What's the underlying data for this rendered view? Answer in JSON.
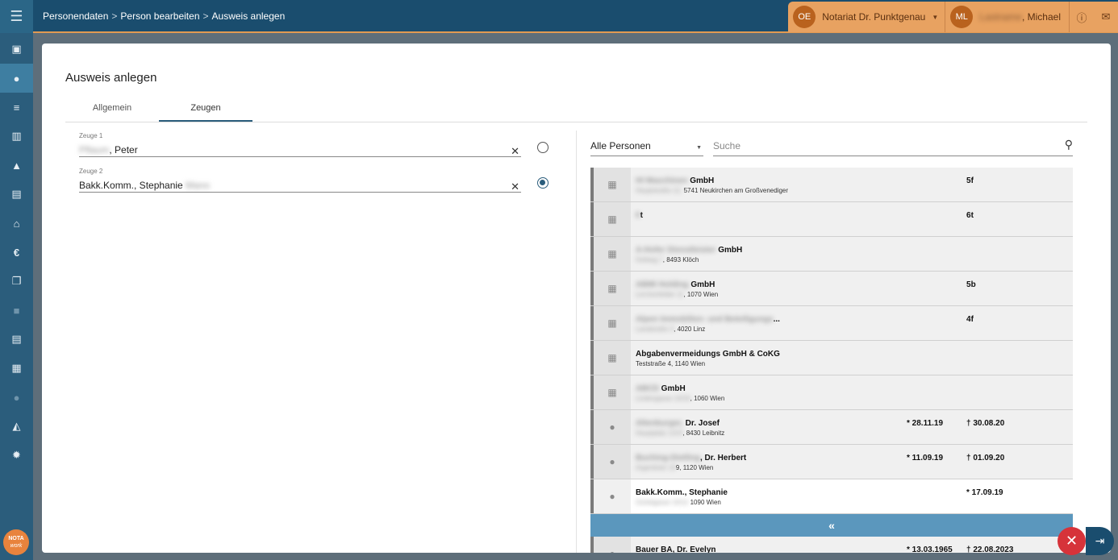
{
  "breadcrumb": {
    "items": [
      "Personendaten",
      "Person bearbeiten",
      "Ausweis anlegen"
    ],
    "separator": ">"
  },
  "header": {
    "org_initials": "OE",
    "org_name": "Notariat Dr. Punktgenau",
    "user_initials": "ML",
    "user_name_suffix": ", Michael",
    "user_name_redacted": "Lastname"
  },
  "sidebar": {
    "logo_top": "NOTA",
    "logo_bottom": "work"
  },
  "page": {
    "title": "Ausweis anlegen",
    "tabs": [
      "Allgemein",
      "Zeugen"
    ]
  },
  "form": {
    "zeuge1": {
      "label": "Zeuge 1",
      "value_redacted": "Pflaum",
      "value_suffix": ", Peter"
    },
    "zeuge2": {
      "label": "Zeuge 2",
      "value_prefix": "Bakk.Komm., Stephanie ",
      "value_redacted": "Mano"
    }
  },
  "filter": {
    "selected": "Alle Personen",
    "search_placeholder": "Suche"
  },
  "list": {
    "rows": [
      {
        "type": "company",
        "title_redacted": "HI Maschinen",
        "title": " GmbH",
        "sub_redacted": "Hauptstraße 12,",
        "sub": " 5741 Neukirchen am Großvenediger",
        "c1": "",
        "c2_redacted": "5",
        "c2": "f"
      },
      {
        "type": "company",
        "title_redacted": "6",
        "title": "t",
        "sub_redacted": "",
        "sub": "",
        "c1": "",
        "c2_redacted": "6",
        "c2": "t"
      },
      {
        "type": "company",
        "title_redacted": "A-Hofer Dienstleister",
        "title": " GmbH",
        "sub_redacted": "Hofweg 7",
        "sub": ", 8493 Klöch",
        "c1": "",
        "c2_redacted": "",
        "c2": ""
      },
      {
        "type": "company",
        "title_redacted": "ABMI Holding",
        "title": " GmbH",
        "sub_redacted": "Lerchenfelder 11",
        "sub": ", 1070 Wien",
        "c1": "",
        "c2_redacted": "5",
        "c2": "b"
      },
      {
        "type": "company",
        "title_redacted": "Alpen Immobilien- und Beteiligungs",
        "title": "...",
        "sub_redacted": "Landstraße 3",
        "sub": ", 4020 Linz",
        "c1": "",
        "c2_redacted": "4",
        "c2": "f"
      },
      {
        "type": "company",
        "title_redacted": "",
        "title": "Abgabenvermeidungs GmbH & CoKG",
        "sub_redacted": "",
        "sub": "Teststraße 4, 1140 Wien",
        "c1": "",
        "c2_redacted": "",
        "c2": ""
      },
      {
        "type": "company",
        "title_redacted": "ABCD",
        "title": " GmbH",
        "sub_redacted": "Lindengasse 14/16",
        "sub": ", 1060 Wien",
        "c1": "",
        "c2_redacted": "",
        "c2": ""
      },
      {
        "type": "person",
        "title_redacted": "Altenburger,",
        "title": " Dr. Josef",
        "sub_redacted": "Hauptplatz 1/2/3",
        "sub": ", 8430 Leibnitz",
        "c1": "* 28.11.19",
        "c2_redacted": "",
        "c2": "† 30.08.20"
      },
      {
        "type": "person",
        "title_redacted": "Buching-Dietling",
        "title": ", Dr. Herbert",
        "sub_redacted": "Argentinier 19",
        "sub": "9, 1120 Wien",
        "c1": "* 11.09.19",
        "c2_redacted": "",
        "c2": "† 01.09.20"
      },
      {
        "type": "person",
        "title_redacted": "",
        "title": "Bakk.Komm., Stephanie",
        "sub_redacted": "Gürtelgasse 10/12",
        "sub": " 1090 Wien",
        "c1": "",
        "c2_redacted": "",
        "c2": "* 17.09.19",
        "selected": true
      }
    ],
    "last_row": {
      "title": "Bauer BA, Dr. Evelyn",
      "c1": "* 13.03.1965",
      "c2": "† 22.08.2023"
    }
  },
  "buttons": {
    "collapse": "«",
    "close": "✕",
    "exit": "⇥"
  }
}
